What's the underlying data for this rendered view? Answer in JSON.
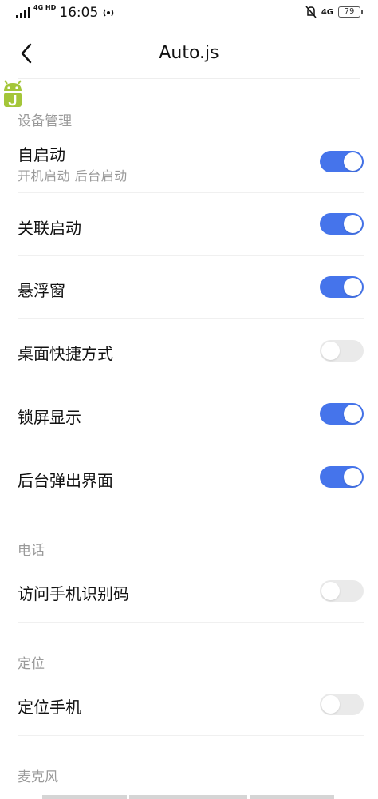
{
  "status_bar": {
    "network_type": "4G HD",
    "time": "16:05",
    "right_network": "4G",
    "battery": "79"
  },
  "header": {
    "title": "Auto.js"
  },
  "sections": [
    {
      "title": "设备管理",
      "items": [
        {
          "label": "自启动",
          "sublabel": "开机启动  后台启动",
          "enabled": true
        },
        {
          "label": "关联启动",
          "enabled": true
        },
        {
          "label": "悬浮窗",
          "enabled": true
        },
        {
          "label": "桌面快捷方式",
          "enabled": false
        },
        {
          "label": "锁屏显示",
          "enabled": true
        },
        {
          "label": "后台弹出界面",
          "enabled": true
        }
      ]
    },
    {
      "title": "电话",
      "items": [
        {
          "label": "访问手机识别码",
          "enabled": false
        }
      ]
    },
    {
      "title": "定位",
      "items": [
        {
          "label": "定位手机",
          "enabled": false
        }
      ]
    },
    {
      "title": "麦克风",
      "items": []
    }
  ],
  "colors": {
    "toggle_on": "#4574eb",
    "toggle_off": "#eaeaea",
    "section_text": "#9a9a9a"
  }
}
